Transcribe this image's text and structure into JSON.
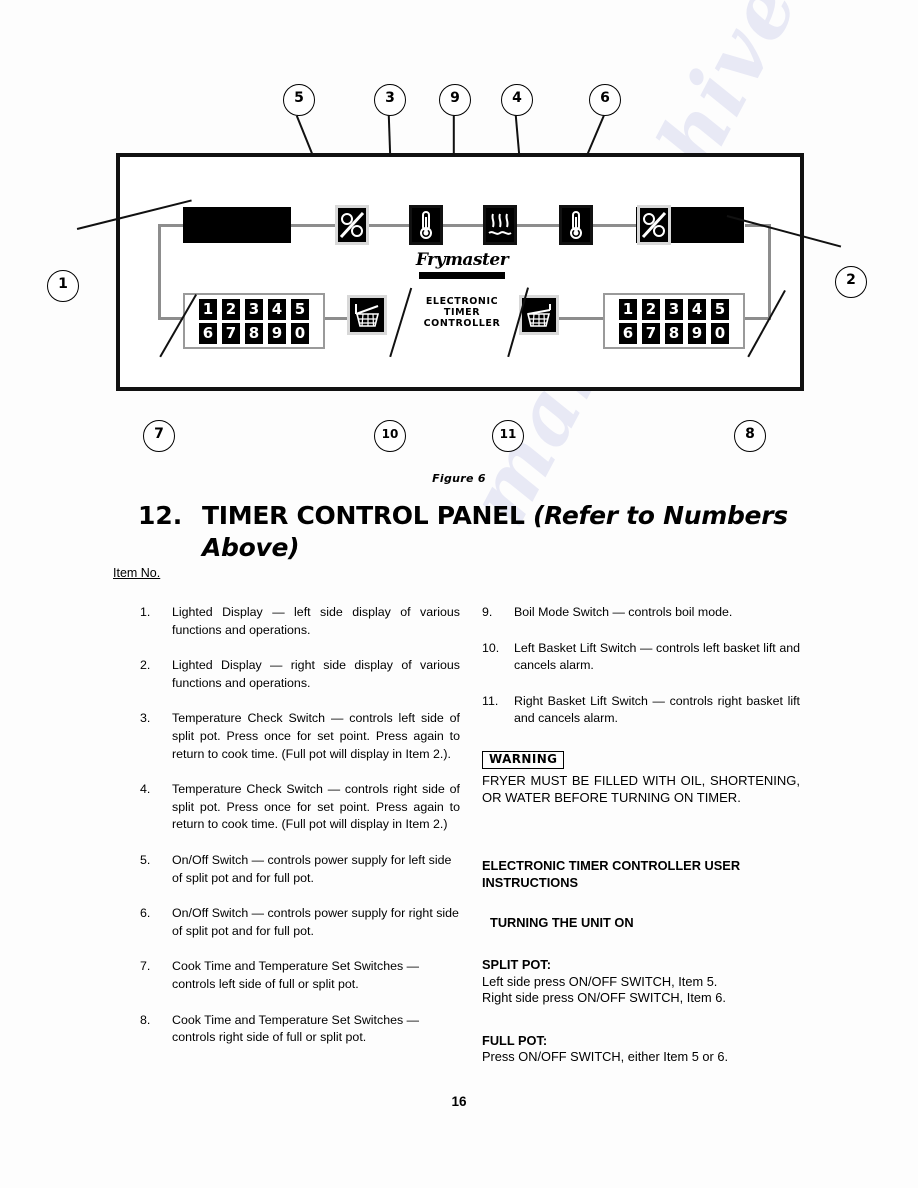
{
  "figure": {
    "caption": "Figure 6",
    "brand": {
      "name": "Frymaster",
      "sub_line1": "ELECTRONIC",
      "sub_line2": "TIMER",
      "sub_line3": "CONTROLLER"
    },
    "keypad_row1": [
      "1",
      "2",
      "3",
      "4",
      "5"
    ],
    "keypad_row2": [
      "6",
      "7",
      "8",
      "9",
      "0"
    ],
    "callouts": {
      "top": [
        "5",
        "3",
        "9",
        "4",
        "6"
      ],
      "left": "1",
      "right": "2",
      "bottom": [
        "7",
        "10",
        "11",
        "8"
      ]
    },
    "icons": {
      "onoff_left": "on-off-switch-icon",
      "temp_left": "thermometer-icon",
      "boil": "boil-mode-icon",
      "temp_right": "thermometer-icon",
      "onoff_right": "on-off-switch-icon",
      "basket_left": "basket-lift-icon",
      "basket_right": "basket-lift-icon",
      "display_left": "lighted-display",
      "display_right": "lighted-display"
    }
  },
  "heading": {
    "number": "12.",
    "title_plain": "TIMER CONTROL PANEL ",
    "title_italic": "(Refer to Numbers Above)"
  },
  "item_no_label": "Item No.",
  "items_left": [
    {
      "num": "1.",
      "text": "Lighted Display — left side display of various functions and operations."
    },
    {
      "num": "2.",
      "text": "Lighted Display — right side display of various functions and operations."
    },
    {
      "num": "3.",
      "text": "Temperature Check Switch — controls left side of split pot. Press once for set point. Press again to return to cook time. (Full pot will display in Item 2.)."
    },
    {
      "num": "4.",
      "text": "Temperature Check Switch — controls right side of split pot. Press once for set point. Press again to return to cook time. (Full pot will display in Item 2.)"
    },
    {
      "num": "5.",
      "text": "On/Off Switch — controls power supply for left side of split pot and for full pot."
    },
    {
      "num": "6.",
      "text": "On/Off Switch — controls power supply for right side of split pot and for full pot."
    },
    {
      "num": "7.",
      "text": "Cook Time and Temperature Set Switches — controls left side of full or split pot."
    },
    {
      "num": "8.",
      "text": "Cook Time and Temperature Set Switches — controls right side of full or split pot."
    }
  ],
  "items_right": [
    {
      "num": "9.",
      "text": "Boil Mode Switch — controls boil mode."
    },
    {
      "num": "10.",
      "text": "Left Basket Lift Switch — controls left basket lift and cancels alarm."
    },
    {
      "num": "11.",
      "text": "Right Basket Lift Switch — controls right basket lift and cancels alarm."
    }
  ],
  "warning": {
    "badge": "WARNING",
    "text": "FRYER MUST BE FILLED WITH OIL, SHORTENING, OR WATER BEFORE TURNING ON TIMER."
  },
  "instructions": {
    "heading": "ELECTRONIC TIMER CONTROLLER USER INSTRUCTIONS",
    "subheading": "TURNING THE UNIT ON",
    "split_pot_title": "SPLIT POT:",
    "split_pot_line1": "Left side press ON/OFF SWITCH, Item 5.",
    "split_pot_line2": "Right side press ON/OFF SWITCH, Item 6.",
    "full_pot_title": "FULL POT:",
    "full_pot_line1": "Press ON/OFF SWITCH, either Item 5 or 6."
  },
  "page_number": "16",
  "watermark": {
    "text": "manualshive.com"
  }
}
